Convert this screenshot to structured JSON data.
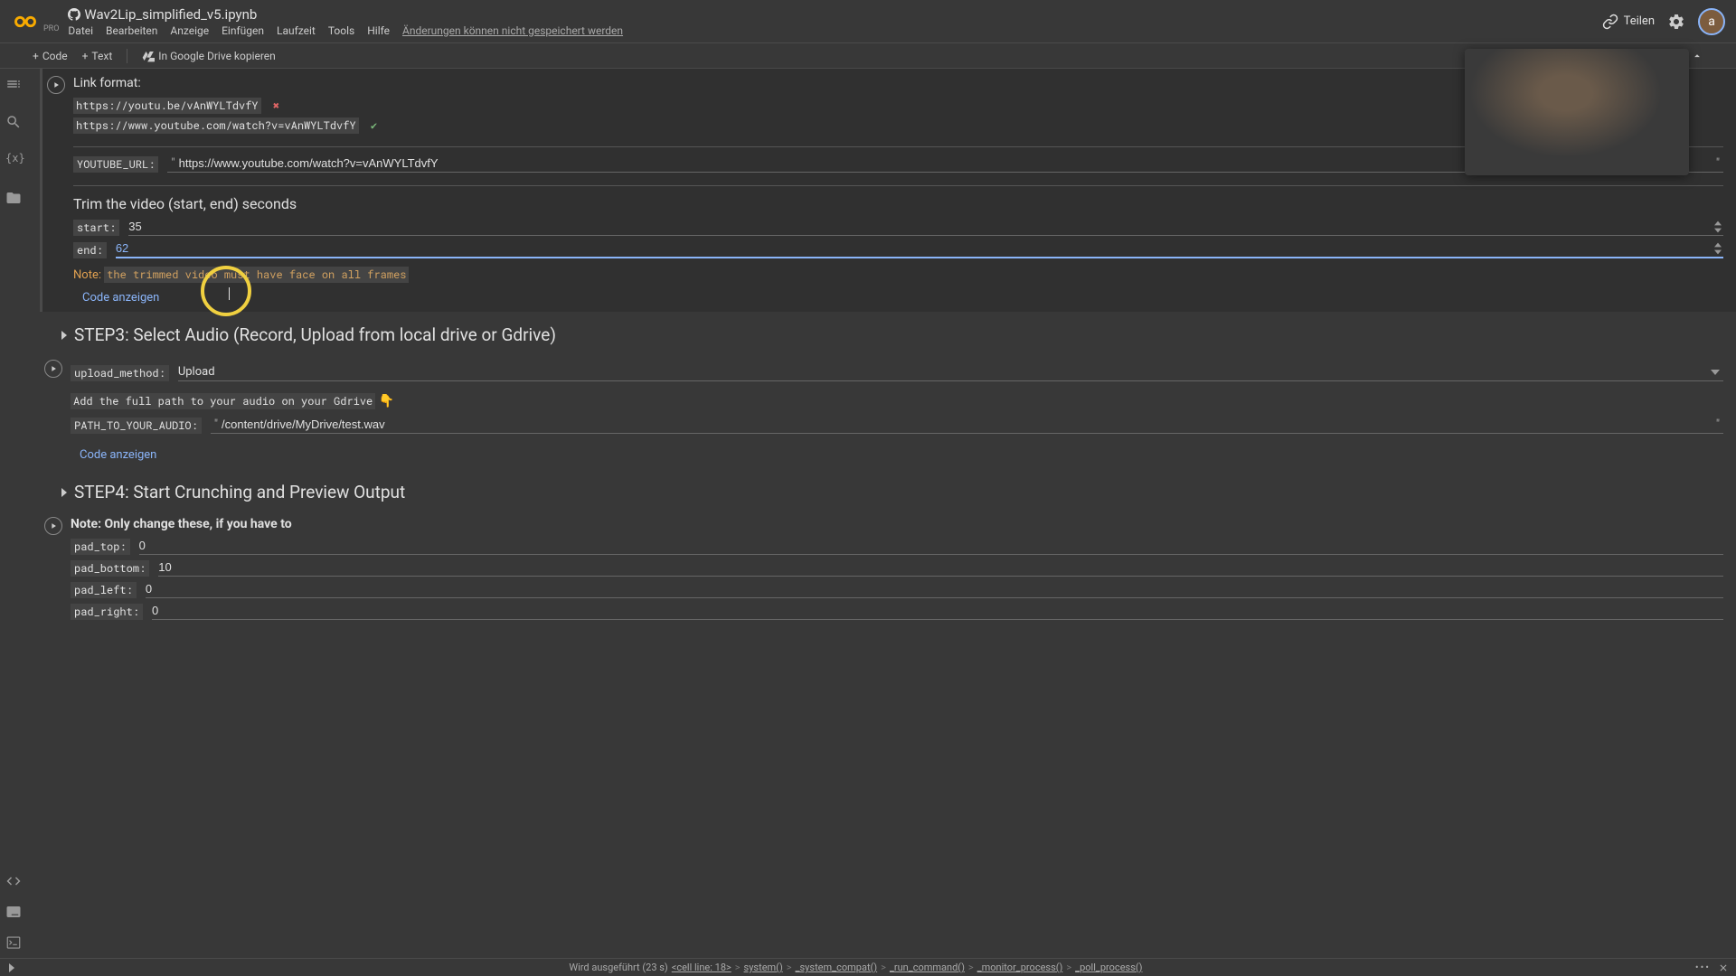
{
  "header": {
    "title": "Wav2Lip_simplified_v5.ipynb",
    "pro": "PRO",
    "share": "Teilen",
    "avatar": "a"
  },
  "menu": {
    "datei": "Datei",
    "bearbeiten": "Bearbeiten",
    "anzeige": "Anzeige",
    "einfuegen": "Einfügen",
    "laufzeit": "Laufzeit",
    "tools": "Tools",
    "hilfe": "Hilfe",
    "save_warning": "Änderungen können nicht gespeichert werden"
  },
  "toolbar": {
    "code": "Code",
    "text": "Text",
    "copy_drive": "In Google Drive kopieren"
  },
  "cell1": {
    "link_format": "Link format:",
    "bad_url": "https://youtu.be/vAnWYLTdvfY",
    "good_url": "https://www.youtube.com/watch?v=vAnWYLTdvfY",
    "youtube_url_label": "YOUTUBE_URL:",
    "youtube_url_value": "https://www.youtube.com/watch?v=vAnWYLTdvfY",
    "trim_title": "Trim the video (start, end) seconds",
    "start_label": "start:",
    "start_value": "35",
    "end_label": "end:",
    "end_value": "62",
    "note_label": "Note:",
    "note_text": "the trimmed video must have face on all frames",
    "show_code": "Code anzeigen"
  },
  "step3": {
    "title": "STEP3: Select Audio (Record, Upload from local drive or Gdrive)",
    "upload_label": "upload_method:",
    "upload_value": "Upload",
    "gdrive_hint": "Add the full path to your audio on your Gdrive",
    "point": "👇",
    "path_label": "PATH_TO_YOUR_AUDIO:",
    "path_value": "/content/drive/MyDrive/test.wav",
    "show_code": "Code anzeigen"
  },
  "step4": {
    "title": "STEP4: Start Crunching and Preview Output",
    "note": "Note: Only change these, if you have to",
    "pad_top_label": "pad_top:",
    "pad_top_value": "0",
    "pad_bottom_label": "pad_bottom:",
    "pad_bottom_value": "10",
    "pad_left_label": "pad_left:",
    "pad_left_value": "0",
    "pad_right_label": "pad_right:",
    "pad_right_value": "0"
  },
  "footer": {
    "status": "Wird ausgeführt (23 s)",
    "f1": "<cell line: 18>",
    "f2": "system()",
    "f3": "_system_compat()",
    "f4": "_run_command()",
    "f5": "_monitor_process()",
    "f6": "_poll_process()",
    "dots": "•••"
  }
}
